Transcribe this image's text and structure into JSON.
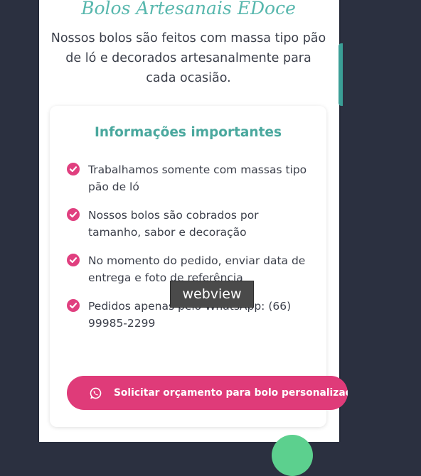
{
  "header": {
    "brand_title": "Bolos Artesanais EDoce",
    "intro": "Nossos bolos são feitos com massa tipo pão de ló e decorados artesanalmente para cada ocasião."
  },
  "info_card": {
    "title": "Informações importantes",
    "items": [
      "Trabalhamos somente com massas tipo pão de ló",
      "Nossos bolos são cobrados por tamanho, sabor e decoração",
      "No momento do pedido, enviar data de entrega e foto de referência",
      "Pedidos apenas pelo WhatsApp: (66) 99985-2299"
    ]
  },
  "cta": {
    "label": "Solicitar orçamento para bolo personalizado",
    "icon": "whatsapp-icon"
  },
  "overlay": {
    "tooltip": "webview"
  },
  "colors": {
    "accent_pink": "#df3b79",
    "accent_teal": "#4aa89e",
    "background": "#2b3040"
  }
}
